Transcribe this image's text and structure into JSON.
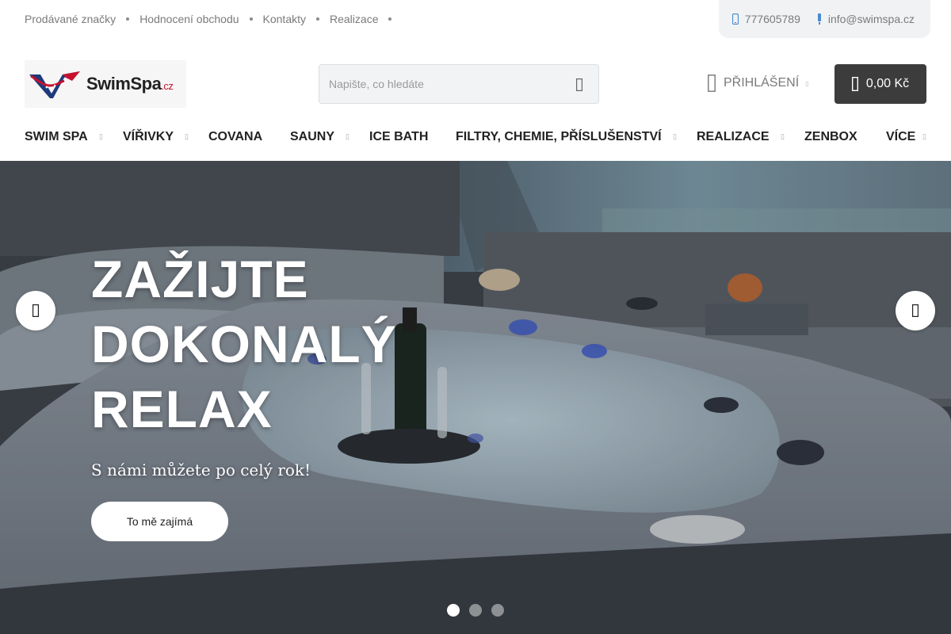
{
  "topbar": {
    "links": [
      "Prodávané značky",
      "Hodnocení obchodu",
      "Kontakty",
      "Realizace"
    ],
    "phone": "777605789",
    "email": "info@swimspa.cz"
  },
  "header": {
    "logo_text": "SwimSpa",
    "logo_suffix": ".cz",
    "search_placeholder": "Napište, co hledáte",
    "login_label": "PŘIHLÁŠENÍ",
    "cart_label": "0,00 Kč"
  },
  "nav": {
    "items": [
      "SWIM SPA",
      "VÍŘIVKY",
      "COVANA",
      "SAUNY",
      "ICE BATH",
      "FILTRY, CHEMIE, PŘÍSLUŠENSTVÍ",
      "REALIZACE",
      "ZENBOX",
      "VÍCE"
    ],
    "has_dropdown": [
      true,
      true,
      false,
      true,
      false,
      true,
      true,
      false,
      true
    ]
  },
  "hero": {
    "title_lines": [
      "ZAŽIJTE",
      "DOKONALÝ",
      "RELAX"
    ],
    "subtitle": "S námi můžete po celý rok!",
    "cta_label": "To mě zajímá",
    "slides_total": 3,
    "active_slide": 1
  },
  "colors": {
    "cart_bg": "#3c3c3c",
    "contact_bg": "#f1f2f4",
    "logo_red": "#c8102e",
    "logo_blue": "#1d3b7a"
  }
}
